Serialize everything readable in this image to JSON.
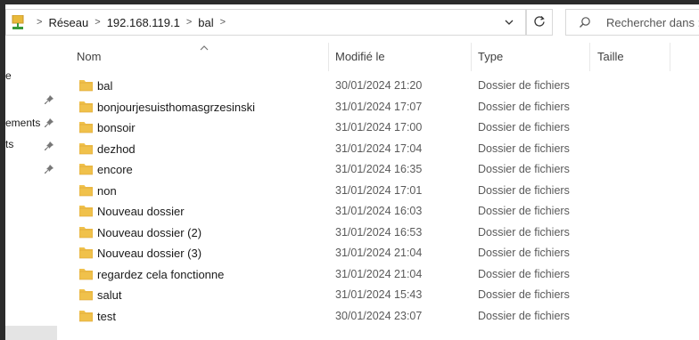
{
  "address": {
    "crumbs": [
      "Réseau",
      "192.168.119.1",
      "bal"
    ],
    "separator": ">"
  },
  "search": {
    "placeholder": "Rechercher dans :"
  },
  "nav": {
    "items": [
      "e",
      "ements",
      "ts"
    ]
  },
  "columns": {
    "name": "Nom",
    "modified": "Modifié le",
    "type": "Type",
    "size": "Taille"
  },
  "files": [
    {
      "name": "bal",
      "modified": "30/01/2024 21:20",
      "type": "Dossier de fichiers"
    },
    {
      "name": "bonjourjesuisthomasgrzesinski",
      "modified": "31/01/2024 17:07",
      "type": "Dossier de fichiers"
    },
    {
      "name": "bonsoir",
      "modified": "31/01/2024 17:00",
      "type": "Dossier de fichiers"
    },
    {
      "name": "dezhod",
      "modified": "31/01/2024 17:04",
      "type": "Dossier de fichiers"
    },
    {
      "name": "encore",
      "modified": "31/01/2024 16:35",
      "type": "Dossier de fichiers"
    },
    {
      "name": "non",
      "modified": "31/01/2024 17:01",
      "type": "Dossier de fichiers"
    },
    {
      "name": "Nouveau dossier",
      "modified": "31/01/2024 16:03",
      "type": "Dossier de fichiers"
    },
    {
      "name": "Nouveau dossier (2)",
      "modified": "31/01/2024 16:53",
      "type": "Dossier de fichiers"
    },
    {
      "name": "Nouveau dossier (3)",
      "modified": "31/01/2024 21:04",
      "type": "Dossier de fichiers"
    },
    {
      "name": "regardez cela fonctionne",
      "modified": "31/01/2024 21:04",
      "type": "Dossier de fichiers"
    },
    {
      "name": "salut",
      "modified": "31/01/2024 15:43",
      "type": "Dossier de fichiers"
    },
    {
      "name": "test",
      "modified": "30/01/2024 23:07",
      "type": "Dossier de fichiers"
    }
  ],
  "colors": {
    "folder": "#f0c14b",
    "folder_dark": "#dca536",
    "frame": "#2b2b2b"
  }
}
